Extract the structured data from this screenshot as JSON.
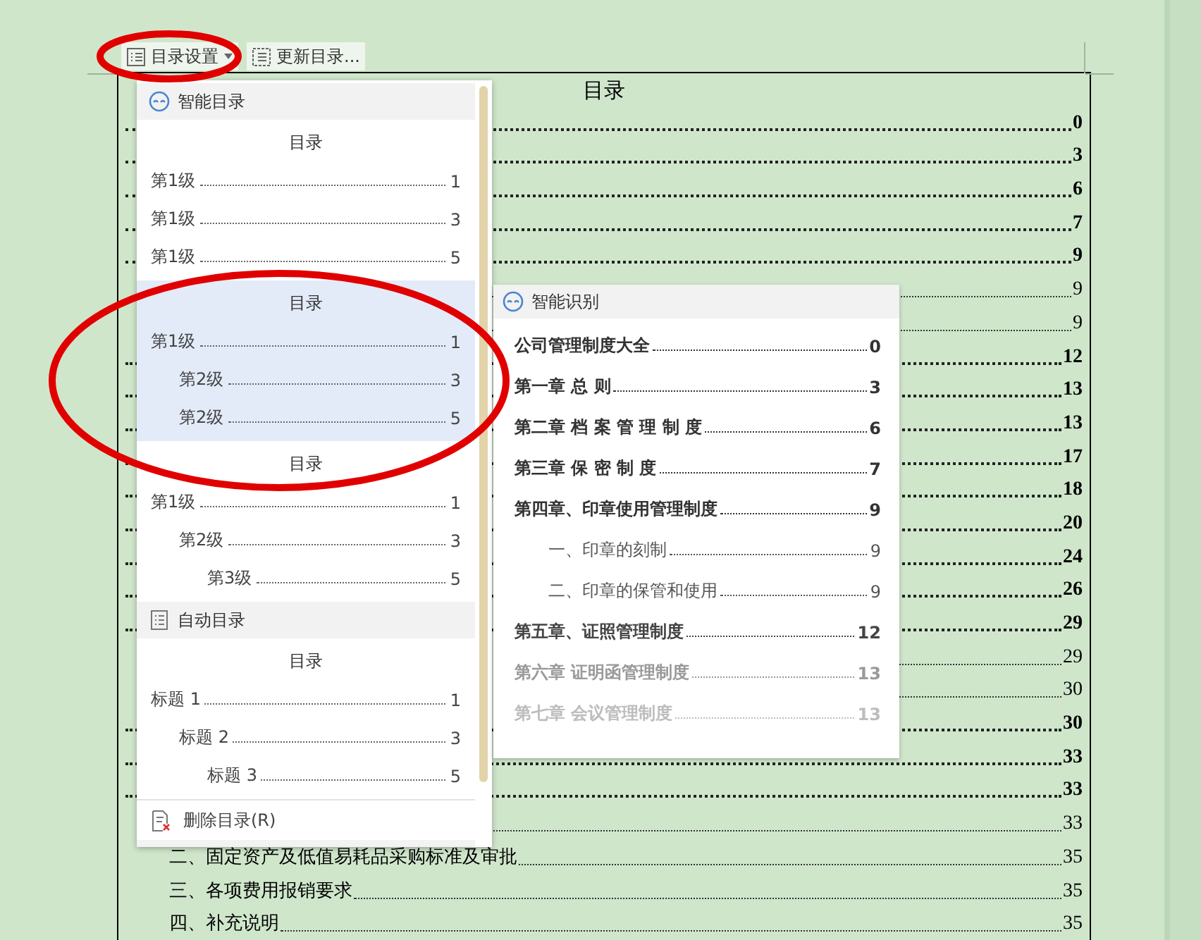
{
  "toolbar": {
    "buttons": [
      {
        "label": "目录设置",
        "has_menu": true
      },
      {
        "label": "更新目录...",
        "has_menu": false
      }
    ]
  },
  "document": {
    "title": "目录",
    "rows": [
      {
        "kind": "chapter",
        "page": "0"
      },
      {
        "kind": "chapter",
        "page": "3"
      },
      {
        "kind": "chapter",
        "page": "6"
      },
      {
        "kind": "chapter",
        "page": "7"
      },
      {
        "kind": "chapter",
        "page": "9"
      },
      {
        "kind": "section",
        "page": "9"
      },
      {
        "kind": "section",
        "page": "9"
      },
      {
        "kind": "chapter",
        "page": "12"
      },
      {
        "kind": "chapter",
        "page": "13"
      },
      {
        "kind": "chapter",
        "page": "13"
      },
      {
        "kind": "chapter",
        "page": "17"
      },
      {
        "kind": "chapter",
        "page": "18"
      },
      {
        "kind": "chapter",
        "page": "20"
      },
      {
        "kind": "chapter",
        "page": "24"
      },
      {
        "kind": "chapter",
        "page": "26"
      },
      {
        "kind": "chapter",
        "page": "29"
      },
      {
        "kind": "section",
        "page": "29"
      },
      {
        "kind": "section",
        "page": "30"
      },
      {
        "kind": "chapter",
        "page": "30"
      },
      {
        "kind": "chapter",
        "page": "33"
      },
      {
        "kind": "chapter",
        "page": "33"
      },
      {
        "kind": "section",
        "page": "33"
      },
      {
        "kind": "section",
        "text": "二、固定资产及低值易耗品采购标准及审批",
        "page": "35"
      },
      {
        "kind": "section",
        "text": "三、各项费用报销要求",
        "page": "35"
      },
      {
        "kind": "section",
        "text": "四、补充说明",
        "page": "35"
      }
    ]
  },
  "toc_menu": {
    "sections": [
      {
        "title": "智能目录",
        "kind": "smart",
        "styles": [
          {
            "heading": "目录",
            "selected": false,
            "entries": [
              {
                "label": "第1级",
                "page": "1"
              },
              {
                "label": "第1级",
                "page": "3"
              },
              {
                "label": "第1级",
                "page": "5"
              }
            ]
          },
          {
            "heading": "目录",
            "selected": true,
            "entries": [
              {
                "label": "第1级",
                "page": "1",
                "children": [
                  {
                    "label": "第2级",
                    "page": "3"
                  },
                  {
                    "label": "第2级",
                    "page": "5"
                  }
                ]
              }
            ]
          },
          {
            "heading": "目录",
            "selected": false,
            "entries": [
              {
                "label": "第1级",
                "page": "1",
                "children": [
                  {
                    "label": "第2级",
                    "page": "3",
                    "children": [
                      {
                        "label": "第3级",
                        "page": "5"
                      }
                    ]
                  }
                ]
              }
            ]
          }
        ]
      },
      {
        "title": "自动目录",
        "kind": "auto",
        "styles": [
          {
            "heading": "目录",
            "selected": false,
            "entries": [
              {
                "label": "标题 1",
                "page": "1",
                "children": [
                  {
                    "label": "标题 2",
                    "page": "3",
                    "children": [
                      {
                        "label": "标题 3",
                        "page": "5"
                      }
                    ]
                  }
                ]
              }
            ]
          }
        ]
      }
    ],
    "delete_item": {
      "label": "删除目录(R)"
    }
  },
  "smart_panel": {
    "title": "智能识别",
    "entries": [
      {
        "label": "公司管理制度大全",
        "page": "0",
        "color": "#333333"
      },
      {
        "label": "第一章 总 则",
        "page": "3",
        "color": "#333333"
      },
      {
        "label": "第二章 档 案 管 理 制 度",
        "page": "6",
        "color": "#333333"
      },
      {
        "label": "第三章 保 密 制 度",
        "page": "7",
        "color": "#333333"
      },
      {
        "label": "第四章、印章使用管理制度",
        "page": "9",
        "color": "#333333",
        "children": [
          {
            "label": "一、印章的刻制",
            "page": "9",
            "color": "#555555"
          },
          {
            "label": "二、印章的保管和使用",
            "page": "9",
            "color": "#555555"
          }
        ]
      },
      {
        "label": "第五章、证照管理制度",
        "page": "12",
        "color": "#444444"
      },
      {
        "label": "第六章 证明函管理制度",
        "page": "13",
        "color": "#9a9a9a"
      },
      {
        "label": "第七章 会议管理制度",
        "page": "13",
        "color": "#bdbdbd"
      }
    ]
  }
}
